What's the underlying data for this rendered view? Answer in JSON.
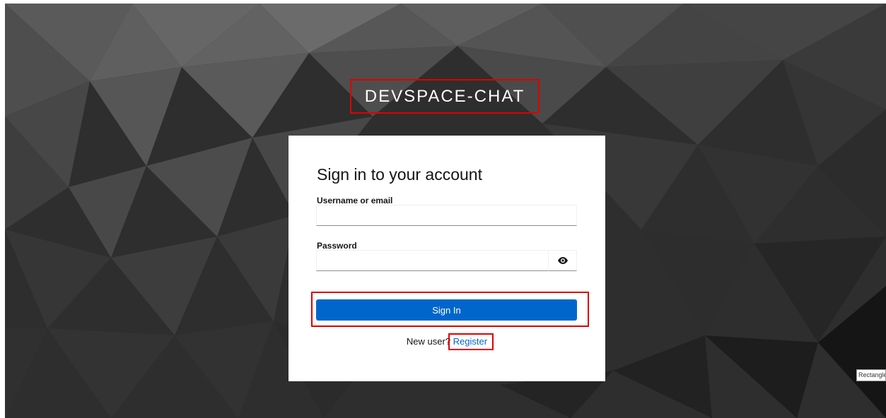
{
  "brand": {
    "name": "DEVSPACE-CHAT"
  },
  "login": {
    "title": "Sign in to your account",
    "username_label": "Username or email",
    "username_value": "",
    "password_label": "Password",
    "password_value": "",
    "submit_label": "Sign In",
    "new_user_text": "New user?",
    "register_label": "Register"
  },
  "tooltip": {
    "text": "Rectangle"
  },
  "colors": {
    "primary": "#0066cc",
    "highlight": "#e00000",
    "background": "#2a2a2a"
  },
  "icons": {
    "password_toggle": "eye-icon"
  }
}
